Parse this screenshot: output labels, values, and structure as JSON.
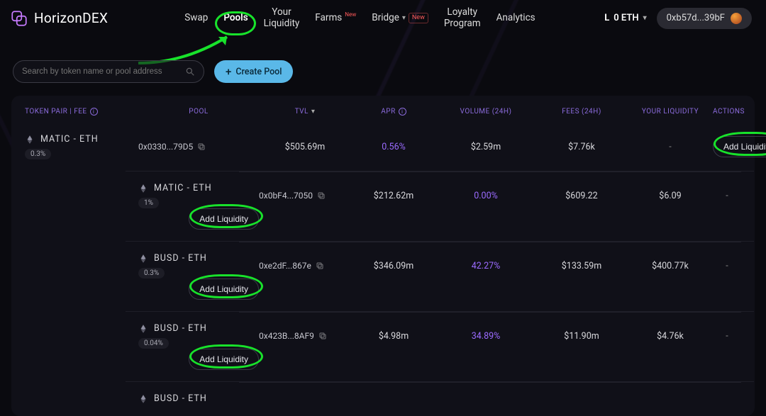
{
  "brand": "HorizonDEX",
  "nav": {
    "swap": "Swap",
    "pools": "Pools",
    "your_liquidity_l1": "Your",
    "your_liquidity_l2": "Liquidity",
    "farms": "Farms",
    "farms_tag": "New",
    "bridge": "Bridge",
    "bridge_tag": "New",
    "loyalty_l1": "Loyalty",
    "loyalty_l2": "Program",
    "analytics": "Analytics"
  },
  "wallet": {
    "chain_icon": "L",
    "balance": "0 ETH",
    "address": "0xb57d...39bF"
  },
  "search": {
    "placeholder": "Search by token name or pool address"
  },
  "create_pool": "Create Pool",
  "headers": {
    "pair": "TOKEN PAIR | FEE",
    "pool": "POOL",
    "tvl": "TVL",
    "apr": "APR",
    "vol": "VOLUME (24H)",
    "fees": "FEES (24H)",
    "yl": "YOUR LIQUIDITY",
    "actions": "ACTIONS"
  },
  "rows": [
    {
      "pair": "MATIC - ETH",
      "fee": "0.3%",
      "pool": "0x0330...79D5",
      "tvl": "$505.69m",
      "apr": "0.56%",
      "vol": "$2.59m",
      "fees": "$7.76k",
      "yl": "-",
      "action": "Add Liquidity"
    },
    {
      "pair": "MATIC - ETH",
      "fee": "1%",
      "pool": "0x0bF4...7050",
      "tvl": "$212.62m",
      "apr": "0.00%",
      "vol": "$609.22",
      "fees": "$6.09",
      "yl": "-",
      "action": "Add Liquidity"
    },
    {
      "pair": "BUSD - ETH",
      "fee": "0.3%",
      "pool": "0xe2dF...867e",
      "tvl": "$346.09m",
      "apr": "42.27%",
      "vol": "$133.59m",
      "fees": "$400.77k",
      "yl": "-",
      "action": "Add Liquidity"
    },
    {
      "pair": "BUSD - ETH",
      "fee": "0.04%",
      "pool": "0x423B...8AF9",
      "tvl": "$4.98m",
      "apr": "34.89%",
      "vol": "$11.90m",
      "fees": "$4.76k",
      "yl": "-",
      "action": "Add Liquidity"
    },
    {
      "pair": "BUSD - ETH",
      "fee": "",
      "pool": "",
      "tvl": "",
      "apr": "",
      "vol": "",
      "fees": "",
      "yl": "",
      "action": ""
    }
  ]
}
